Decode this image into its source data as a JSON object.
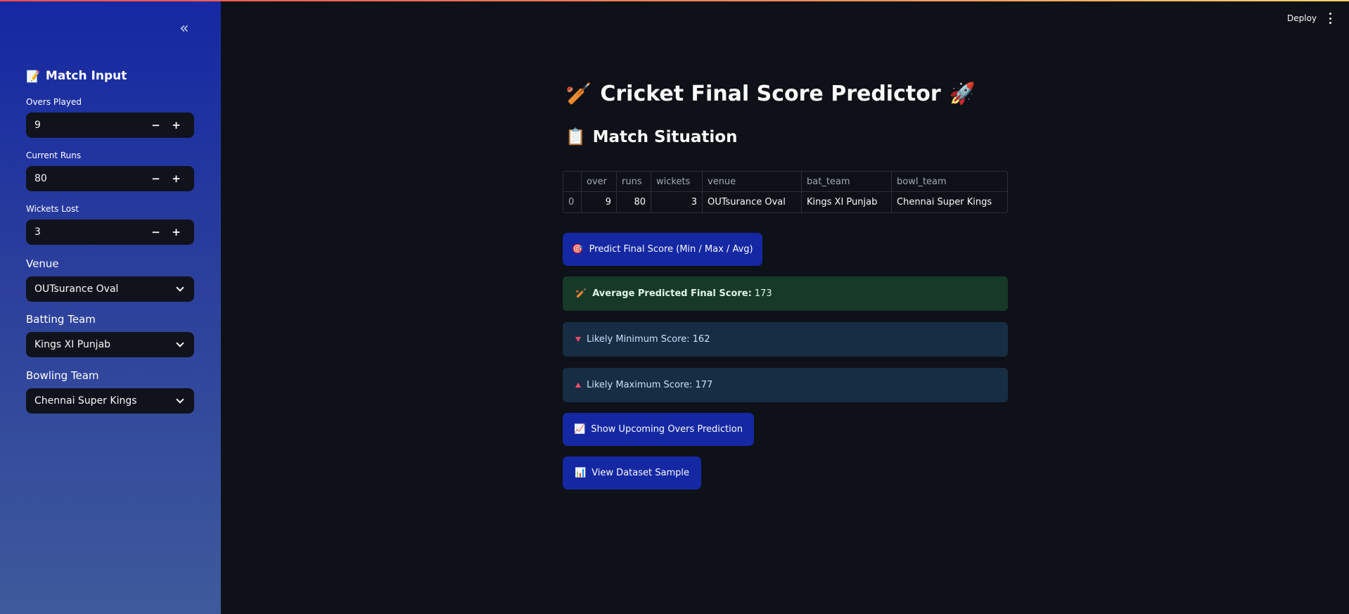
{
  "header": {
    "deploy_label": "Deploy"
  },
  "sidebar": {
    "collapse_glyph": "«",
    "heading_icon": "📝",
    "heading": "Match Input",
    "overs": {
      "label": "Overs Played",
      "value": "9"
    },
    "runs": {
      "label": "Current Runs",
      "value": "80"
    },
    "wickets": {
      "label": "Wickets Lost",
      "value": "3"
    },
    "venue": {
      "label": "Venue",
      "value": "OUTsurance Oval"
    },
    "batting": {
      "label": "Batting Team",
      "value": "Kings XI Punjab"
    },
    "bowling": {
      "label": "Bowling Team",
      "value": "Chennai Super Kings"
    },
    "minus": "−",
    "plus": "+"
  },
  "main": {
    "title_icon_left": "🏏",
    "title": "Cricket Final Score Predictor",
    "title_icon_right": "🚀",
    "subtitle_icon": "📋",
    "subtitle": "Match Situation",
    "table": {
      "columns": [
        "",
        "over",
        "runs",
        "wickets",
        "venue",
        "bat_team",
        "bowl_team"
      ],
      "row": [
        "0",
        "9",
        "80",
        "3",
        "OUTsurance Oval",
        "Kings XI Punjab",
        "Chennai Super Kings"
      ]
    },
    "predict_button": {
      "icon": "🎯",
      "label": "Predict Final Score (Min / Max / Avg)"
    },
    "avg": {
      "icon": "🏏",
      "label": "Average Predicted Final Score:",
      "value": "173"
    },
    "min": {
      "text": "Likely Minimum Score: 162"
    },
    "max": {
      "text": "Likely Maximum Score: 177"
    },
    "upcoming_button": {
      "icon": "📈",
      "label": "Show Upcoming Overs Prediction"
    },
    "dataset_button": {
      "icon": "📊",
      "label": "View Dataset Sample"
    }
  },
  "colors": {
    "sidebar_top": "#1528a3",
    "background": "#0e1117",
    "button": "#1528a3",
    "success_bg": "#173928",
    "info_bg": "#172d43",
    "accent_red": "#ff4b4b"
  }
}
